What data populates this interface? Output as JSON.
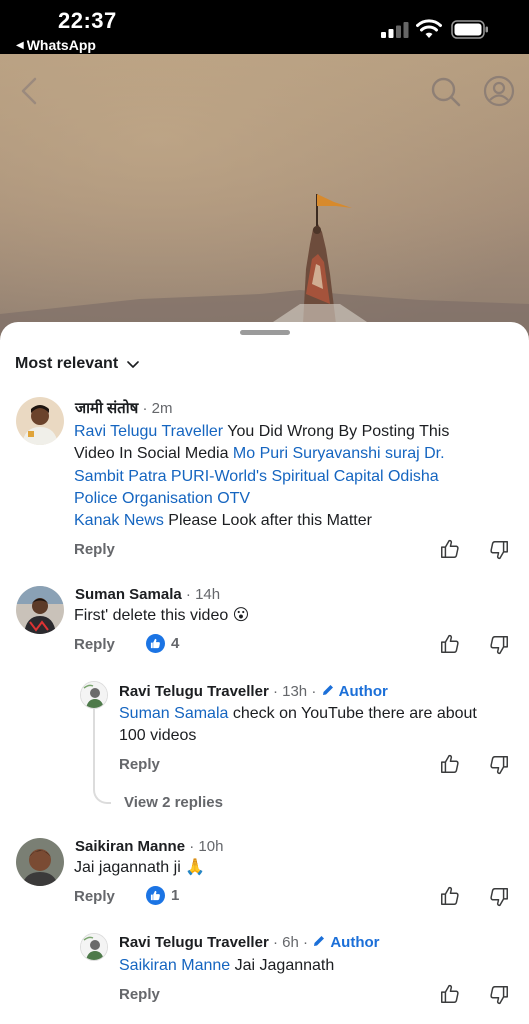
{
  "status_bar": {
    "time": "22:37",
    "back_app": "WhatsApp"
  },
  "video": {
    "controls": [
      "back-icon",
      "search-icon",
      "profile-icon"
    ]
  },
  "sort": {
    "label": "Most relevant"
  },
  "comments": [
    {
      "author": "जामी संतोष",
      "time": "2m",
      "lines": [
        {
          "link": "Ravi Telugu Traveller",
          "text": " You Did Wrong By Posting This"
        },
        {
          "text": "Video In Social Media ",
          "link": "Mo Puri Suryavanshi suraj Dr."
        },
        {
          "link": "Sambit Patra PURI-World's Spiritual Capital Odisha"
        },
        {
          "link": "Police Organisation OTV"
        },
        {
          "link": "Kanak News",
          "text": " Please Look after this Matter"
        }
      ],
      "reply_label": "Reply"
    },
    {
      "author": "Suman Samala",
      "time": "14h",
      "text": "First' delete this video 😮",
      "reply_label": "Reply",
      "likes": "4",
      "replies": [
        {
          "author": "Ravi Telugu Traveller",
          "time": "13h",
          "badge": "Author",
          "link": "Suman Samala",
          "text": " check on YouTube there are about",
          "text2": "100 videos",
          "reply_label": "Reply"
        }
      ],
      "view_replies": "View 2 replies"
    },
    {
      "author": "Saikiran Manne",
      "time": "10h",
      "text": "Jai jagannath ji 🙏",
      "reply_label": "Reply",
      "likes": "1",
      "replies": [
        {
          "author": "Ravi Telugu Traveller",
          "time": "6h",
          "badge": "Author",
          "link": "Saikiran Manne",
          "text": " Jai Jagannath",
          "reply_label": "Reply"
        }
      ]
    }
  ],
  "colors": {
    "link": "#1565c0",
    "like_badge": "#1b74e4",
    "author_badge": "#1b6fd8",
    "muted": "#65676b"
  }
}
